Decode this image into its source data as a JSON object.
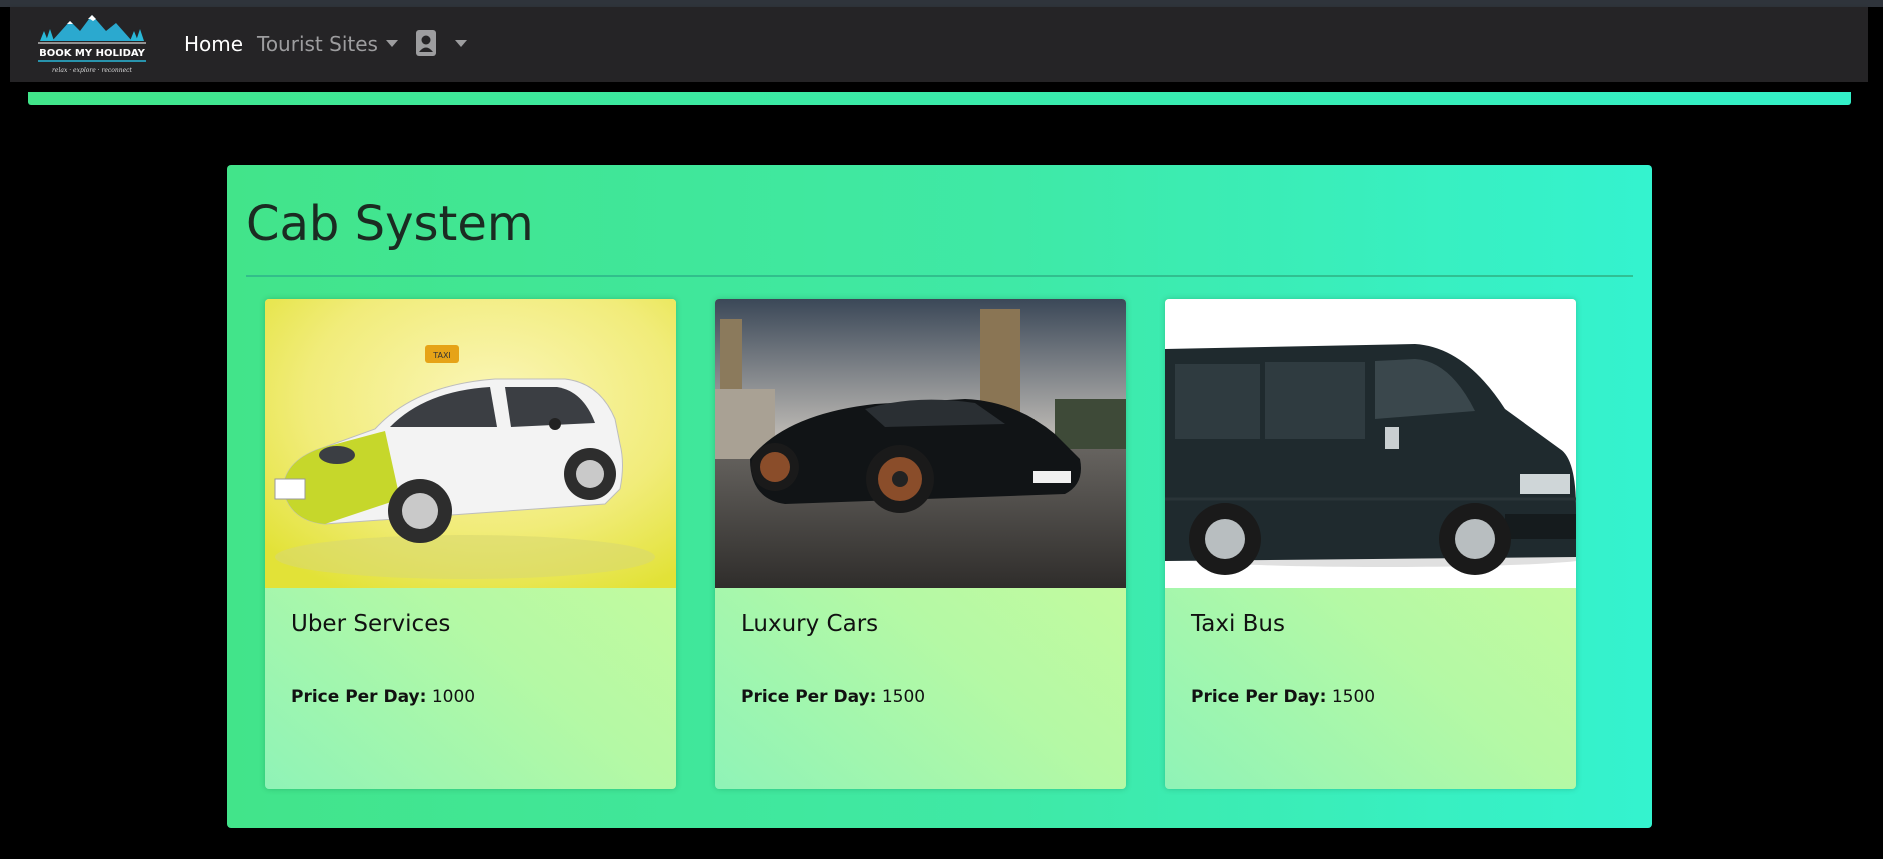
{
  "brand": {
    "logo_text": "BOOK MY HOLIDAY",
    "logo_tagline": "relax · explore · reconnect"
  },
  "nav": {
    "home_label": "Home",
    "tourist_sites_label": "Tourist Sites",
    "profile_icon": "contact-card-icon"
  },
  "page": {
    "title": "Cab System"
  },
  "cabs": [
    {
      "title": "Uber Services",
      "price_label": "Price Per Day:",
      "price": "1000",
      "image": "white taxi hatchback with CITY TAXI roof sign"
    },
    {
      "title": "Luxury Cars",
      "price_label": "Price Per Day:",
      "price": "1500",
      "image": "black sports car in plaza"
    },
    {
      "title": "Taxi Bus",
      "price_label": "Price Per Day:",
      "price": "1500",
      "image": "dark passenger van"
    }
  ],
  "colors": {
    "navbar": "#252426",
    "accent_green": "#42e48a",
    "accent_teal": "#34f3cf",
    "background": "#000000"
  }
}
